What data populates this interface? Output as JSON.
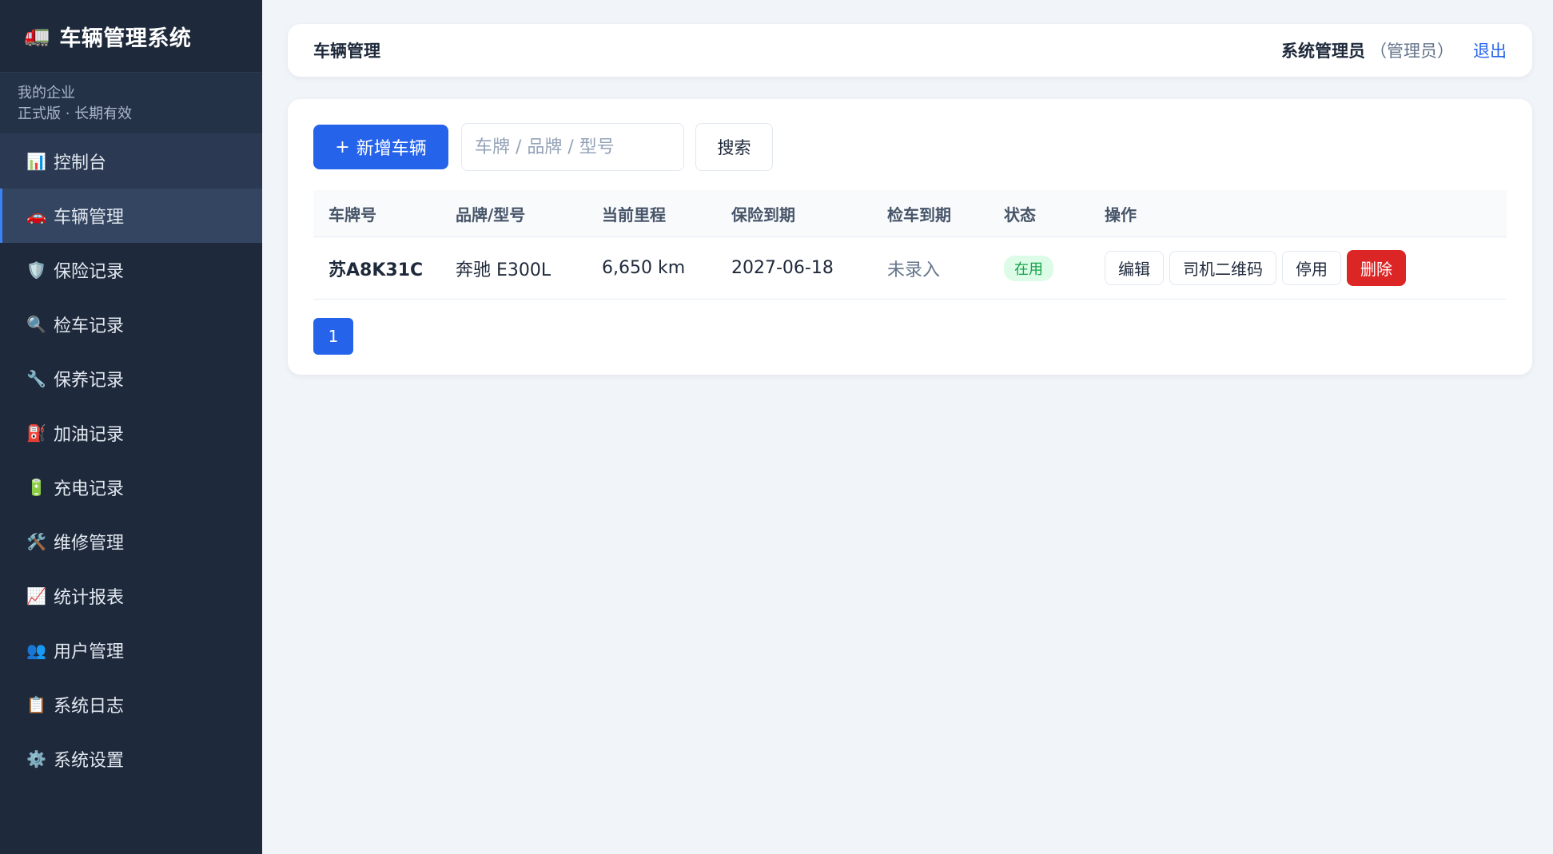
{
  "app": {
    "icon": "truck-icon",
    "title": "车辆管理系统"
  },
  "org": {
    "name": "我的企业",
    "plan": "正式版 · 长期有效"
  },
  "sidebar": {
    "items": [
      {
        "icon": "📊",
        "icon_name": "bar-chart-icon",
        "label": "控制台"
      },
      {
        "icon": "🚗",
        "icon_name": "car-icon",
        "label": "车辆管理"
      },
      {
        "icon": "🛡️",
        "icon_name": "shield-icon",
        "label": "保险记录"
      },
      {
        "icon": "🔍",
        "icon_name": "magnifier-icon",
        "label": "检车记录"
      },
      {
        "icon": "🔧",
        "icon_name": "wrench-icon",
        "label": "保养记录"
      },
      {
        "icon": "⛽",
        "icon_name": "fuel-pump-icon",
        "label": "加油记录"
      },
      {
        "icon": "🔋",
        "icon_name": "battery-icon",
        "label": "充电记录"
      },
      {
        "icon": "🛠️",
        "icon_name": "tools-icon",
        "label": "维修管理"
      },
      {
        "icon": "📈",
        "icon_name": "trend-chart-icon",
        "label": "统计报表"
      },
      {
        "icon": "👥",
        "icon_name": "users-icon",
        "label": "用户管理"
      },
      {
        "icon": "📋",
        "icon_name": "clipboard-icon",
        "label": "系统日志"
      },
      {
        "icon": "⚙️",
        "icon_name": "gear-icon",
        "label": "系统设置"
      }
    ],
    "active_index": 1
  },
  "header": {
    "title": "车辆管理",
    "user_name": "系统管理员",
    "user_role": "（管理员）",
    "logout_label": "退出"
  },
  "toolbar": {
    "add_label": "新增车辆",
    "add_icon": "+",
    "search_placeholder": "车牌 / 品牌 / 型号",
    "search_value": "",
    "search_label": "搜索"
  },
  "table": {
    "columns": [
      "车牌号",
      "品牌/型号",
      "当前里程",
      "保险到期",
      "检车到期",
      "状态",
      "操作"
    ],
    "rows": [
      {
        "plate": "苏A8K31C",
        "model": "奔驰 E300L",
        "mileage": "6,650 km",
        "insurance_due": "2027-06-18",
        "inspection_due": "未录入",
        "status": "在用",
        "actions": {
          "edit": "编辑",
          "qr": "司机二维码",
          "disable": "停用",
          "delete": "删除"
        }
      }
    ]
  },
  "pagination": {
    "current": "1"
  },
  "colors": {
    "sidebar_bg": "#1e293b",
    "primary": "#2563eb",
    "danger": "#dc2626",
    "success": "#16a34a",
    "page_bg": "#f1f4f9"
  }
}
